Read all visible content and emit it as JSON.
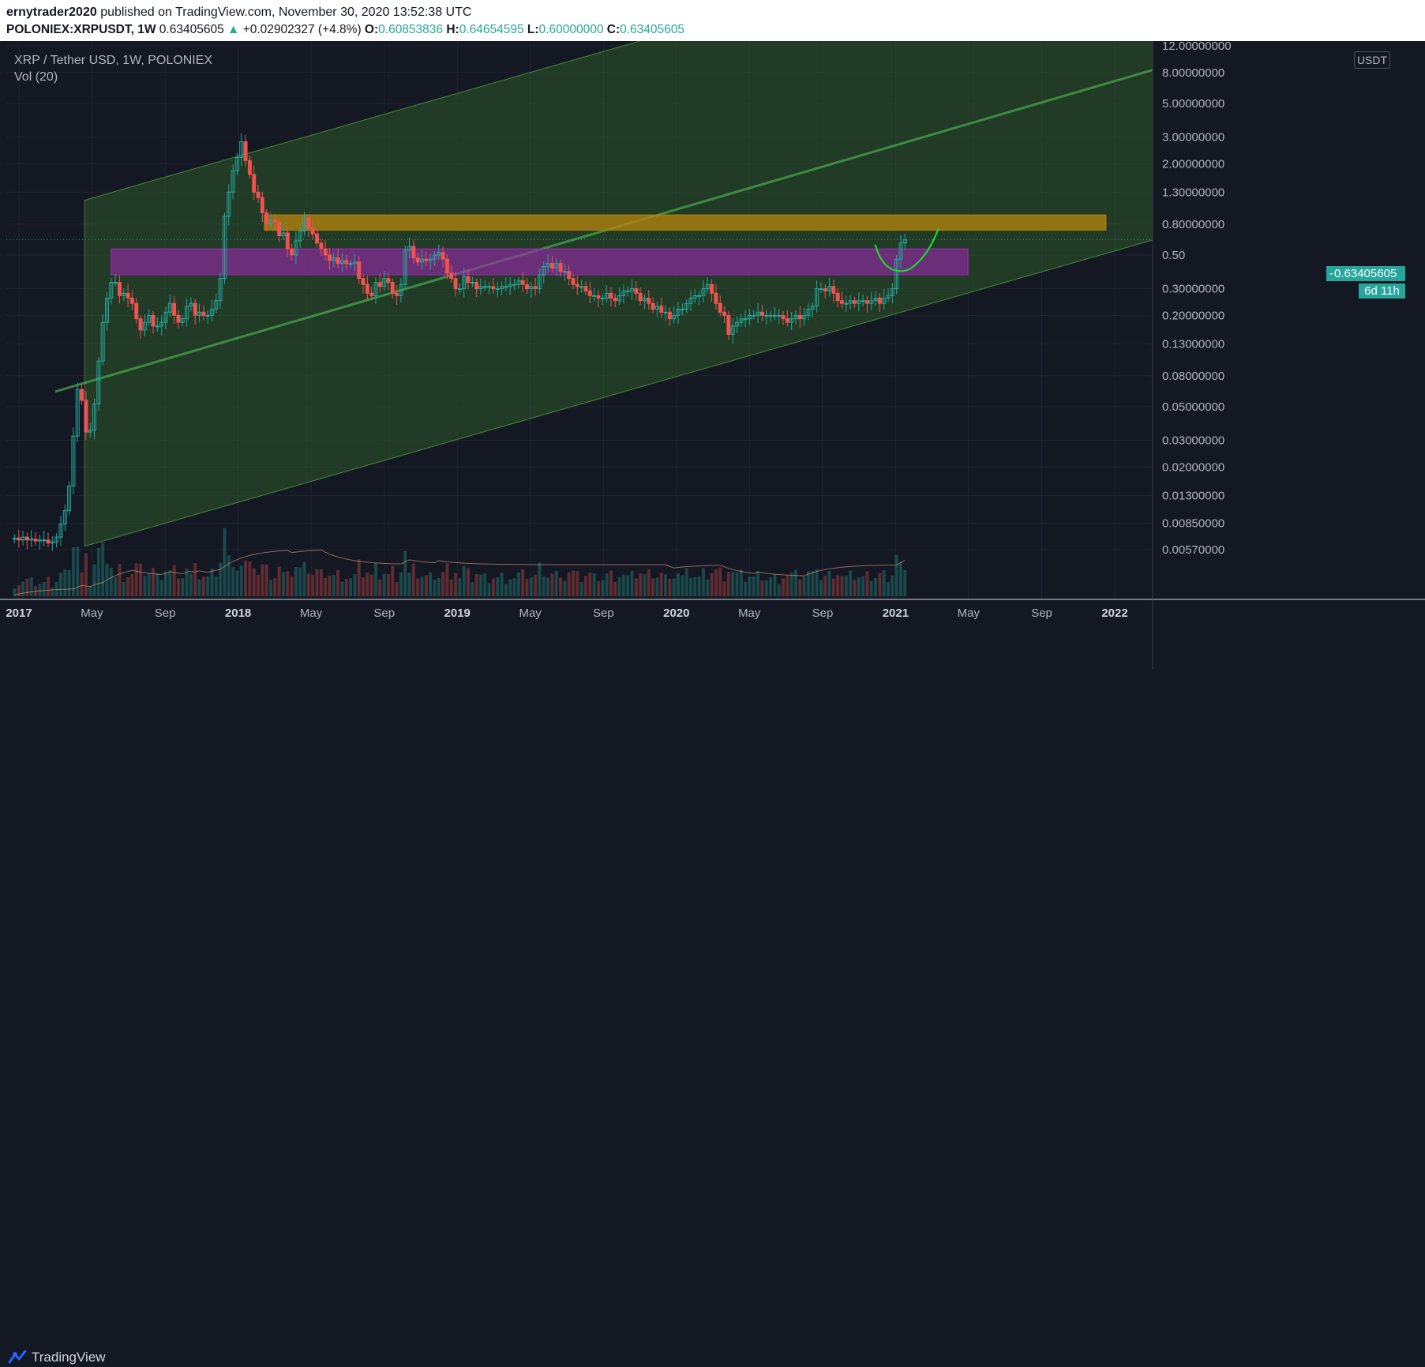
{
  "header": {
    "author": "ernytrader2020",
    "published_text": "published on TradingView.com, November 30, 2020 13:52:38 UTC",
    "symbol": "POLONIEX:XRPUSDT",
    "interval": "1W",
    "last": "0.63405605",
    "change": "+0.02902327 (+4.8%)",
    "o_label": "O:",
    "o_value": "0.60853836",
    "h_label": "H:",
    "h_value": "0.64654595",
    "l_label": "L:",
    "l_value": "0.60000000",
    "c_label": "C:",
    "c_value": "0.63405605"
  },
  "legend": {
    "title": "XRP / Tether USD, 1W, POLONIEX",
    "indicator": "Vol (20)"
  },
  "price_axis": {
    "currency_badge": "USDT",
    "current_price": "0.63405605",
    "countdown": "6d 11h"
  },
  "footer": {
    "brand": "TradingView"
  },
  "colors": {
    "background": "#141823",
    "up": "#26a69a",
    "down": "#ef5350",
    "channel_fill": "#2b5a2a",
    "channel_mid": "#4caf50",
    "resistance_zone": "#b8860b",
    "support_zone": "#9c27b0",
    "projection": "#22d42e"
  },
  "icons": {
    "logo": "tradingview-logo-icon",
    "price-marker": "triangle-up-icon"
  },
  "chart_data": {
    "type": "candlestick",
    "title": "XRP / Tether USD, 1W, POLONIEX",
    "scale": "log",
    "ylim": [
      0.0057,
      12.0
    ],
    "y_ticks": [
      "12.00000000",
      "8.00000000",
      "5.00000000",
      "3.00000000",
      "2.00000000",
      "1.30000000",
      "0.80000000",
      "0.50",
      "0.30000000",
      "0.20000000",
      "0.13000000",
      "0.08000000",
      "0.05000000",
      "0.03000000",
      "0.02000000",
      "0.01300000",
      "0.00850000",
      "0.00570000"
    ],
    "y_tick_values": [
      12,
      8,
      5,
      3,
      2,
      1.3,
      0.8,
      0.5,
      0.3,
      0.2,
      0.13,
      0.08,
      0.05,
      0.03,
      0.02,
      0.013,
      0.0085,
      0.0057
    ],
    "x_ticks": [
      "2017",
      "May",
      "Sep",
      "2018",
      "May",
      "Sep",
      "2019",
      "May",
      "Sep",
      "2020",
      "May",
      "Sep",
      "2021",
      "May",
      "Sep",
      "2022"
    ],
    "x_tick_values": [
      2017.0,
      2017.333,
      2017.667,
      2018.0,
      2018.333,
      2018.667,
      2019.0,
      2019.333,
      2019.667,
      2020.0,
      2020.333,
      2020.667,
      2021.0,
      2021.333,
      2021.667,
      2022.0
    ],
    "xlim": [
      2016.96,
      2022.55
    ],
    "grid": true,
    "closes_weekly": [
      0.0068,
      0.0066,
      0.0069,
      0.0066,
      0.0067,
      0.0065,
      0.0066,
      0.0066,
      0.0063,
      0.0064,
      0.0069,
      0.0084,
      0.0103,
      0.015,
      0.032,
      0.065,
      0.055,
      0.034,
      0.035,
      0.052,
      0.1,
      0.18,
      0.26,
      0.33,
      0.33,
      0.27,
      0.28,
      0.26,
      0.24,
      0.19,
      0.16,
      0.18,
      0.2,
      0.17,
      0.17,
      0.18,
      0.21,
      0.24,
      0.2,
      0.18,
      0.19,
      0.23,
      0.24,
      0.2,
      0.21,
      0.2,
      0.2,
      0.22,
      0.25,
      0.35,
      0.9,
      1.3,
      1.8,
      2.2,
      2.8,
      2.1,
      1.7,
      1.3,
      1.2,
      0.95,
      0.8,
      0.85,
      0.82,
      0.67,
      0.7,
      0.55,
      0.5,
      0.62,
      0.72,
      0.88,
      0.75,
      0.69,
      0.6,
      0.55,
      0.5,
      0.46,
      0.48,
      0.44,
      0.46,
      0.44,
      0.44,
      0.45,
      0.35,
      0.32,
      0.28,
      0.27,
      0.33,
      0.31,
      0.35,
      0.33,
      0.28,
      0.27,
      0.32,
      0.54,
      0.57,
      0.48,
      0.45,
      0.47,
      0.46,
      0.47,
      0.5,
      0.52,
      0.47,
      0.38,
      0.35,
      0.3,
      0.3,
      0.36,
      0.33,
      0.33,
      0.3,
      0.31,
      0.31,
      0.31,
      0.3,
      0.3,
      0.31,
      0.31,
      0.32,
      0.32,
      0.34,
      0.32,
      0.3,
      0.31,
      0.3,
      0.37,
      0.42,
      0.44,
      0.41,
      0.44,
      0.39,
      0.39,
      0.35,
      0.32,
      0.31,
      0.31,
      0.29,
      0.27,
      0.27,
      0.26,
      0.26,
      0.28,
      0.26,
      0.25,
      0.27,
      0.29,
      0.29,
      0.3,
      0.28,
      0.25,
      0.26,
      0.24,
      0.22,
      0.23,
      0.21,
      0.21,
      0.19,
      0.2,
      0.22,
      0.22,
      0.24,
      0.26,
      0.27,
      0.27,
      0.3,
      0.32,
      0.28,
      0.24,
      0.21,
      0.2,
      0.15,
      0.17,
      0.18,
      0.19,
      0.19,
      0.2,
      0.2,
      0.21,
      0.2,
      0.2,
      0.2,
      0.2,
      0.2,
      0.19,
      0.18,
      0.19,
      0.2,
      0.19,
      0.2,
      0.22,
      0.23,
      0.3,
      0.3,
      0.29,
      0.31,
      0.28,
      0.25,
      0.24,
      0.24,
      0.25,
      0.24,
      0.25,
      0.25,
      0.24,
      0.25,
      0.26,
      0.24,
      0.26,
      0.27,
      0.3,
      0.47,
      0.6,
      0.63
    ],
    "channel": {
      "lower_from": [
        2017.3,
        0.006
      ],
      "lower_to": [
        2022.55,
        0.9
      ],
      "upper_from": [
        2017.3,
        1.15
      ],
      "upper_to": [
        2019.04,
        12.0
      ]
    },
    "zones": [
      {
        "name": "resistance",
        "x": [
          2018.12,
          2021.96
        ],
        "y": [
          0.73,
          0.92
        ]
      },
      {
        "name": "support",
        "x": [
          2017.42,
          2021.33
        ],
        "y": [
          0.37,
          0.55
        ]
      }
    ],
    "volume_ma": true
  }
}
